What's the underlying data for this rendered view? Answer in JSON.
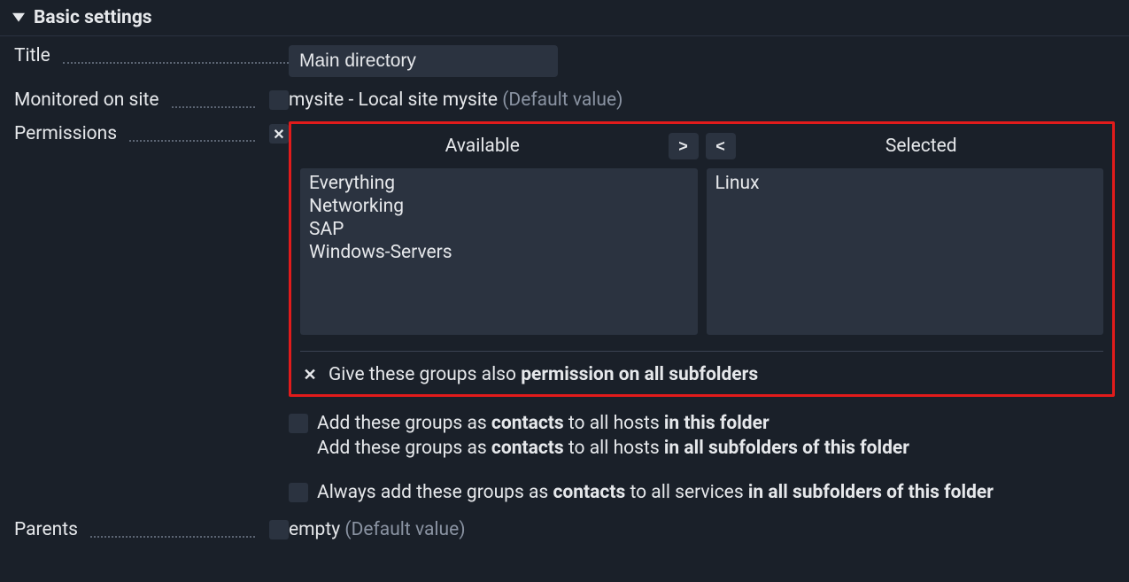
{
  "section": {
    "title": "Basic settings"
  },
  "fields": {
    "title": {
      "label": "Title",
      "value": "Main directory"
    },
    "monitored": {
      "label": "Monitored on site",
      "value_main": "mysite - Local site mysite",
      "value_suffix": "(Default value)"
    },
    "permissions": {
      "label": "Permissions",
      "available_header": "Available",
      "selected_header": "Selected",
      "move_right": ">",
      "move_left": "<",
      "available": [
        "Everything",
        "Networking",
        "SAP",
        "Windows-Servers"
      ],
      "selected": [
        "Linux"
      ],
      "subfolders_prefix": "Give these groups also ",
      "subfolders_bold": "permission on all subfolders",
      "opt1_a": "Add these groups as ",
      "opt1_b": "contacts",
      "opt1_c": " to all hosts ",
      "opt1_d": "in this folder",
      "opt2_a": "Add these groups as ",
      "opt2_b": "contacts",
      "opt2_c": " to all hosts ",
      "opt2_d": "in all subfolders of this folder",
      "opt3_a": "Always add these groups as ",
      "opt3_b": "contacts",
      "opt3_c": " to all services ",
      "opt3_d": "in all subfolders of this folder"
    },
    "parents": {
      "label": "Parents",
      "value_main": "empty",
      "value_suffix": "(Default value)"
    }
  },
  "glyphs": {
    "x": "✕"
  }
}
